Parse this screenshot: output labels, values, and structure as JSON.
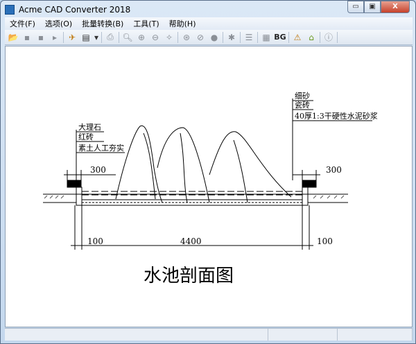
{
  "window": {
    "title": "Acme CAD Converter 2018",
    "min": "▭",
    "max": "▣",
    "close": "X"
  },
  "menu": [
    {
      "label": "文件(F)"
    },
    {
      "label": "选项(O)"
    },
    {
      "label": "批量转换(B)"
    },
    {
      "label": "工具(T)"
    },
    {
      "label": "帮助(H)"
    }
  ],
  "toolbar": {
    "bg_label": "BG"
  },
  "drawing": {
    "left_labels": [
      "大理石",
      "红砖",
      "素土人工夯实"
    ],
    "right_labels": [
      "细砂",
      "瓷砖",
      "40厚1:3干硬性水泥砂浆"
    ],
    "dim_top_left": "300",
    "dim_top_right": "300",
    "dim_bottom_left": "100",
    "dim_bottom_mid": "4400",
    "dim_bottom_right": "100",
    "title": "水池剖面图"
  }
}
